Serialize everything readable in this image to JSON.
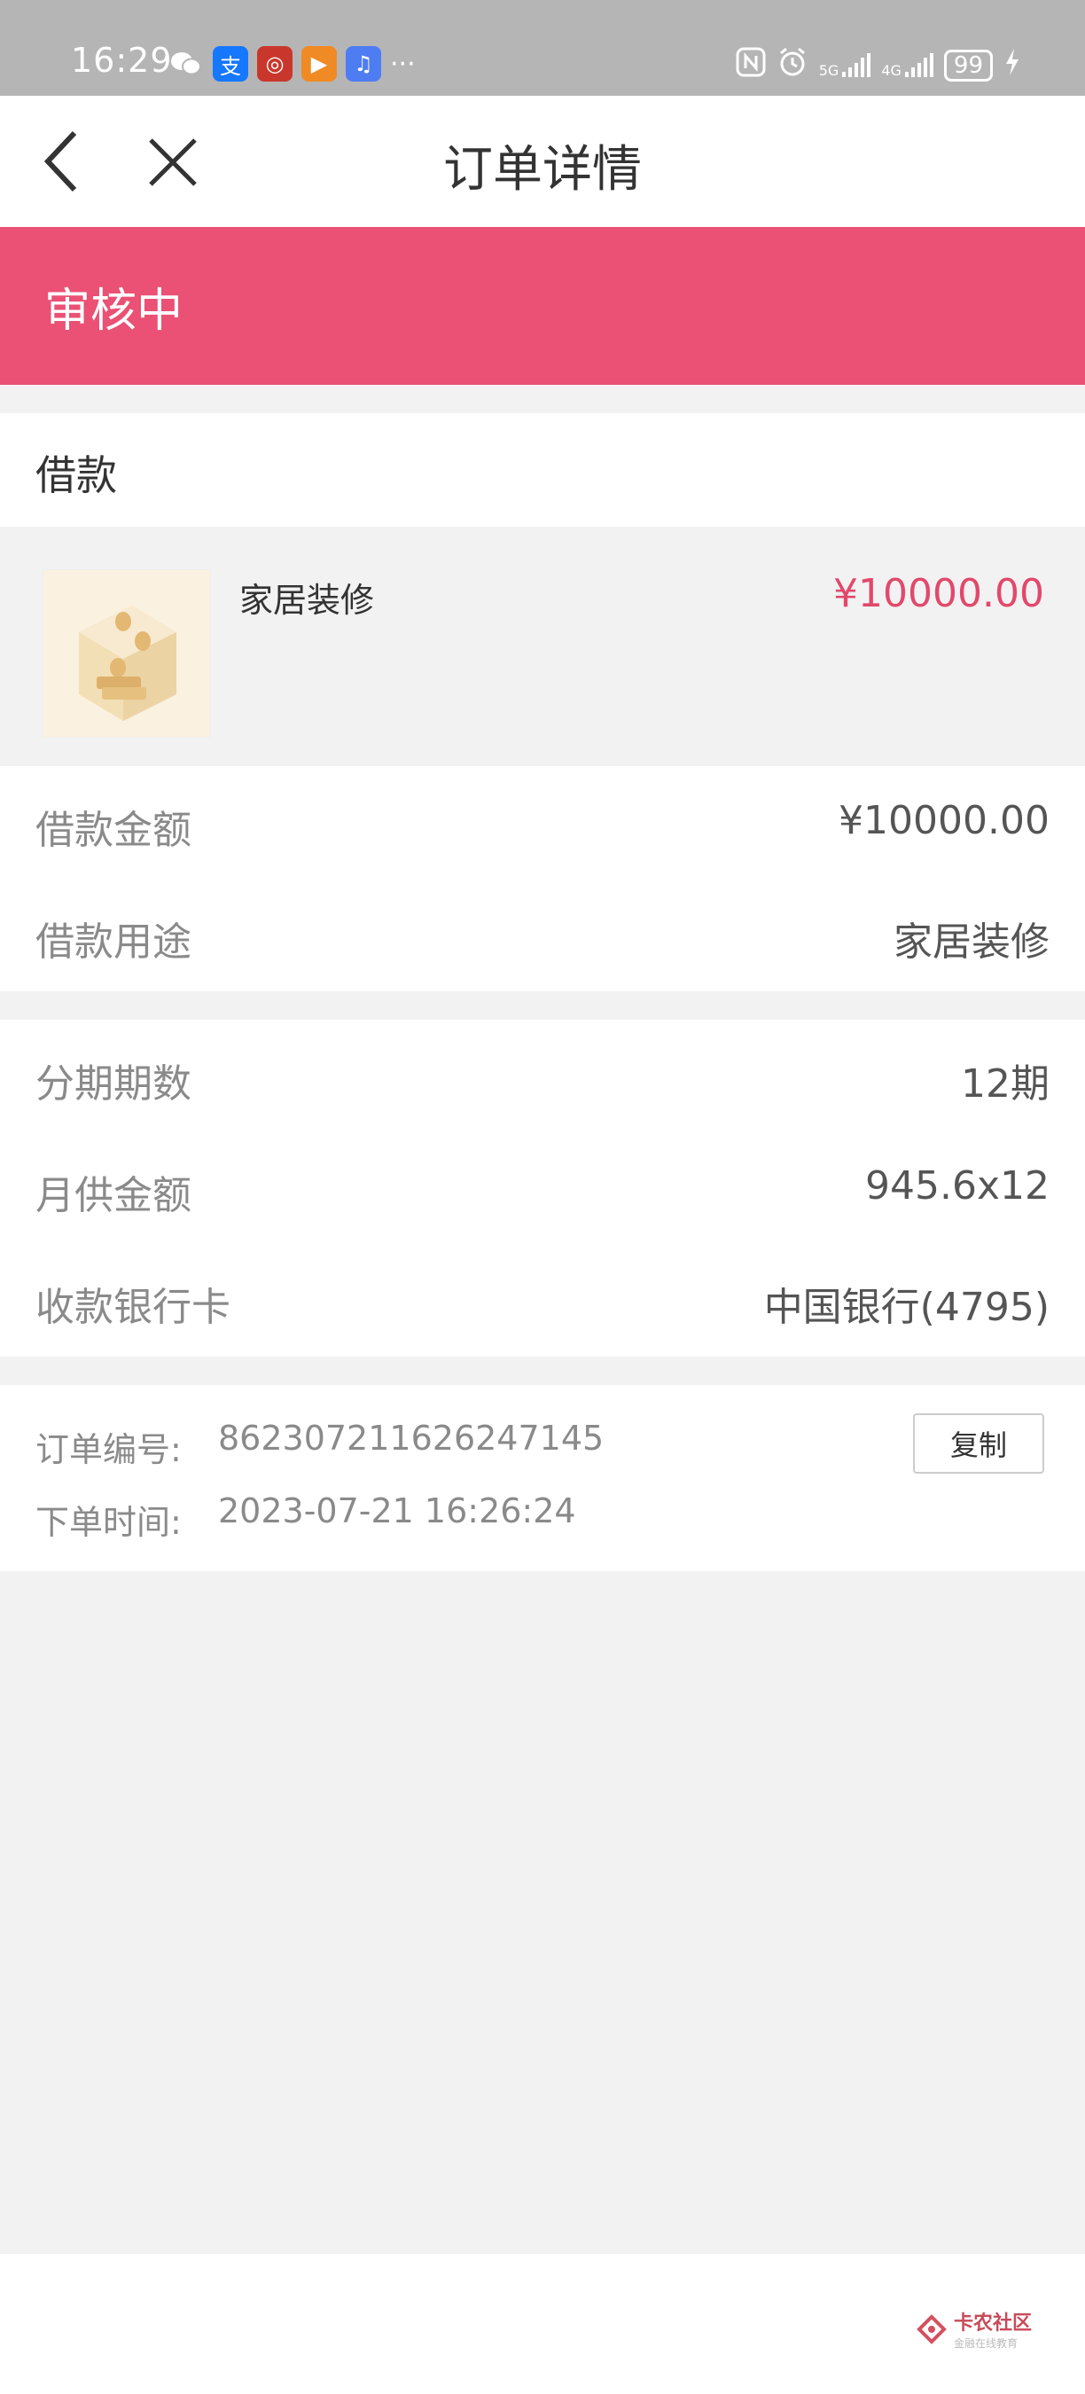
{
  "status_bar": {
    "time": "16:29",
    "more": "···",
    "battery": "99",
    "network_5g": "5G",
    "network_4g": "4G"
  },
  "header": {
    "title": "订单详情"
  },
  "status_banner": {
    "text": "审核中"
  },
  "section": {
    "label": "借款"
  },
  "product": {
    "name": "家居装修",
    "price": "¥10000.00"
  },
  "loan_info": [
    {
      "label": "借款金额",
      "value": "¥10000.00"
    },
    {
      "label": "借款用途",
      "value": "家居装修"
    }
  ],
  "repay_info": [
    {
      "label": "分期期数",
      "value": "12期"
    },
    {
      "label": "月供金额",
      "value": "945.6x12"
    },
    {
      "label": "收款银行卡",
      "value": "中国银行(4795)"
    }
  ],
  "order_meta": {
    "order_no_label": "订单编号:",
    "order_no": "862307211626247145",
    "time_label": "下单时间:",
    "time": "2023-07-21 16:26:24",
    "copy_label": "复制"
  },
  "watermark": {
    "title": "卡农社区",
    "subtitle": "金融在线教育"
  },
  "colors": {
    "accent": "#ea5174",
    "price": "#e2486b"
  }
}
